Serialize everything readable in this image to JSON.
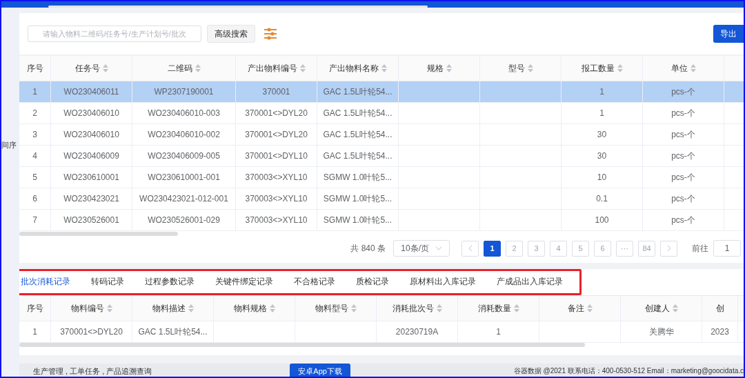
{
  "side_label": "间序",
  "search": {
    "placeholder": "请输入物料二维码/任务号/生产计划号/批次",
    "advanced_button": "高级搜索",
    "export_button": "导出"
  },
  "main_table": {
    "columns": [
      {
        "label": "序号",
        "sortable": false
      },
      {
        "label": "任务号",
        "sortable": true
      },
      {
        "label": "二维码",
        "sortable": true
      },
      {
        "label": "产出物料编号",
        "sortable": true
      },
      {
        "label": "产出物料名称",
        "sortable": true
      },
      {
        "label": "规格",
        "sortable": true
      },
      {
        "label": "型号",
        "sortable": true
      },
      {
        "label": "报工数量",
        "sortable": true
      },
      {
        "label": "单位",
        "sortable": true
      }
    ],
    "rows": [
      {
        "selected": true,
        "cells": [
          "1",
          "WO230406011",
          "WP2307190001",
          "370001",
          "GAC 1.5L叶轮54...",
          "",
          "",
          "1",
          "pcs-个"
        ]
      },
      {
        "selected": false,
        "cells": [
          "2",
          "WO230406010",
          "WO230406010-003",
          "370001<>DYL20",
          "GAC 1.5L叶轮54...",
          "",
          "",
          "1",
          "pcs-个"
        ]
      },
      {
        "selected": false,
        "cells": [
          "3",
          "WO230406010",
          "WO230406010-002",
          "370001<>DYL20",
          "GAC 1.5L叶轮54...",
          "",
          "",
          "30",
          "pcs-个"
        ]
      },
      {
        "selected": false,
        "cells": [
          "4",
          "WO230406009",
          "WO230406009-005",
          "370001<>DYL10",
          "GAC 1.5L叶轮54...",
          "",
          "",
          "30",
          "pcs-个"
        ]
      },
      {
        "selected": false,
        "cells": [
          "5",
          "WO230610001",
          "WO230610001-001",
          "370003<>XYL10",
          "SGMW 1.0叶轮5...",
          "",
          "",
          "10",
          "pcs-个"
        ]
      },
      {
        "selected": false,
        "cells": [
          "6",
          "WO230423021",
          "WO230423021-012-001",
          "370003<>XYL10",
          "SGMW 1.0叶轮5...",
          "",
          "",
          "0.1",
          "pcs-个"
        ]
      },
      {
        "selected": false,
        "cells": [
          "7",
          "WO230526001",
          "WO230526001-029",
          "370003<>XYL10",
          "SGMW 1.0叶轮5...",
          "",
          "",
          "100",
          "pcs-个"
        ]
      }
    ]
  },
  "pagination": {
    "total": "共 840 条",
    "page_size": "10条/页",
    "pages": [
      {
        "label": "1",
        "selected": true
      },
      {
        "label": "2",
        "selected": false
      },
      {
        "label": "3",
        "selected": false
      },
      {
        "label": "4",
        "selected": false
      },
      {
        "label": "5",
        "selected": false
      },
      {
        "label": "6",
        "selected": false
      },
      {
        "label": "···",
        "selected": false
      },
      {
        "label": "84",
        "selected": false
      }
    ],
    "goto_label": "前往",
    "goto_value": "1"
  },
  "tabs": [
    {
      "label": "批次消耗记录",
      "selected": true
    },
    {
      "label": "转码记录",
      "selected": false
    },
    {
      "label": "过程参数记录",
      "selected": false
    },
    {
      "label": "关键件绑定记录",
      "selected": false
    },
    {
      "label": "不合格记录",
      "selected": false
    },
    {
      "label": "质检记录",
      "selected": false
    },
    {
      "label": "原材料出入库记录",
      "selected": false
    },
    {
      "label": "产成品出入库记录",
      "selected": false
    }
  ],
  "detail_table": {
    "columns": [
      {
        "label": "序号",
        "sortable": false
      },
      {
        "label": "物料编号",
        "sortable": true
      },
      {
        "label": "物料描述",
        "sortable": true
      },
      {
        "label": "物料规格",
        "sortable": true
      },
      {
        "label": "物料型号",
        "sortable": true
      },
      {
        "label": "消耗批次号",
        "sortable": true
      },
      {
        "label": "消耗数量",
        "sortable": true
      },
      {
        "label": "备注",
        "sortable": true
      },
      {
        "label": "创建人",
        "sortable": true
      },
      {
        "label": "创",
        "sortable": false
      }
    ],
    "rows": [
      {
        "selected": false,
        "cells": [
          "1",
          "370001<>DYL20",
          "GAC 1.5L叶轮54...",
          "",
          "",
          "20230719A",
          "1",
          "",
          "关腾华",
          "2023"
        ]
      }
    ]
  },
  "footer": {
    "breadcrumb": "生产管理 , 工单任务 , 产品追溯查询",
    "app_button": "安卓App下载",
    "contact": "谷器数据 @2021 联系电话：400-0530-512 Email：marketing@goocidata.c"
  }
}
